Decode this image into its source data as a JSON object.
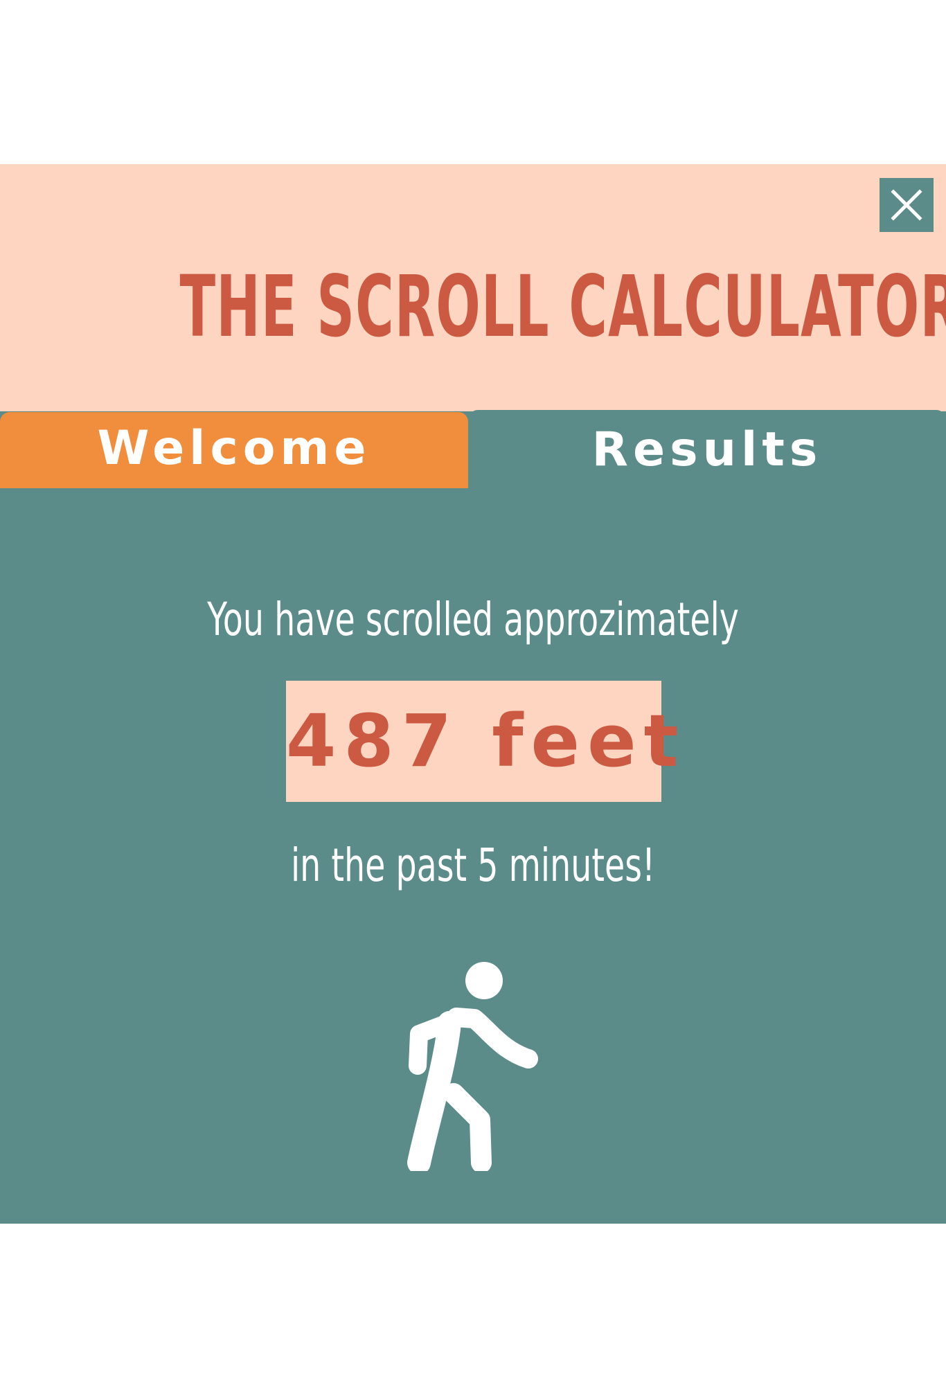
{
  "header": {
    "title": "THE SCROLL CALCULATOR",
    "close_icon": "close-icon"
  },
  "tabs": [
    {
      "label": "Welcome",
      "active": false
    },
    {
      "label": "Results",
      "active": true
    }
  ],
  "results": {
    "intro": "You have scrolled approzimately",
    "distance": "487 feet",
    "timeframe": "in the past 5 minutes!",
    "icon": "walking-person-icon"
  },
  "colors": {
    "header_bg": "#fdd5c1",
    "panel_bg": "#5b8c8a",
    "accent_orange": "#f08e3d",
    "title_red": "#cc5942",
    "text_white": "#ffffff"
  }
}
